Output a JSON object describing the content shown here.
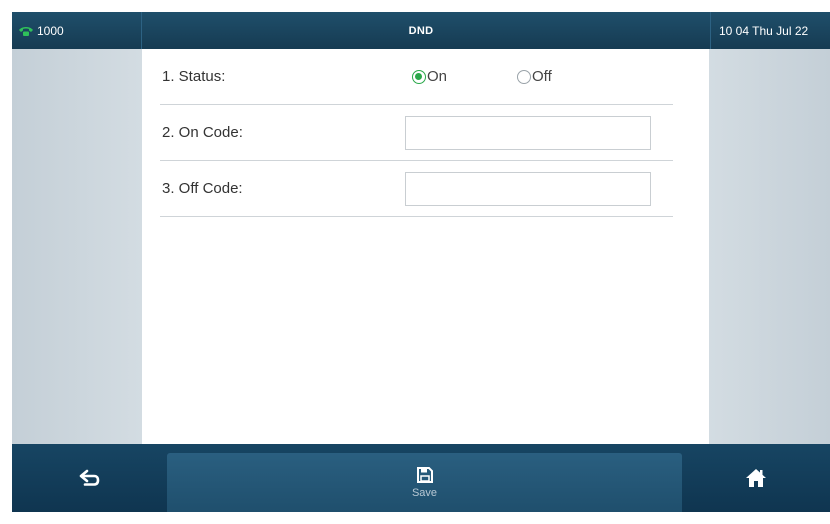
{
  "status_bar": {
    "account": "1000",
    "title": "DND",
    "clock": "10 04 Thu Jul 22",
    "account_icon": "phone-icon"
  },
  "form": {
    "status": {
      "label": "1. Status:",
      "options": [
        "On",
        "Off"
      ],
      "selected": "On"
    },
    "on_code": {
      "label": "2. On Code:",
      "value": ""
    },
    "off_code": {
      "label": "3. Off Code:",
      "value": ""
    }
  },
  "softkeys": {
    "back_icon": "back-arrow-icon",
    "save_label": "Save",
    "save_icon": "floppy-disk-icon",
    "home_icon": "home-icon"
  },
  "colors": {
    "accent_green": "#2aa84a",
    "bar_blue": "#163b52"
  }
}
